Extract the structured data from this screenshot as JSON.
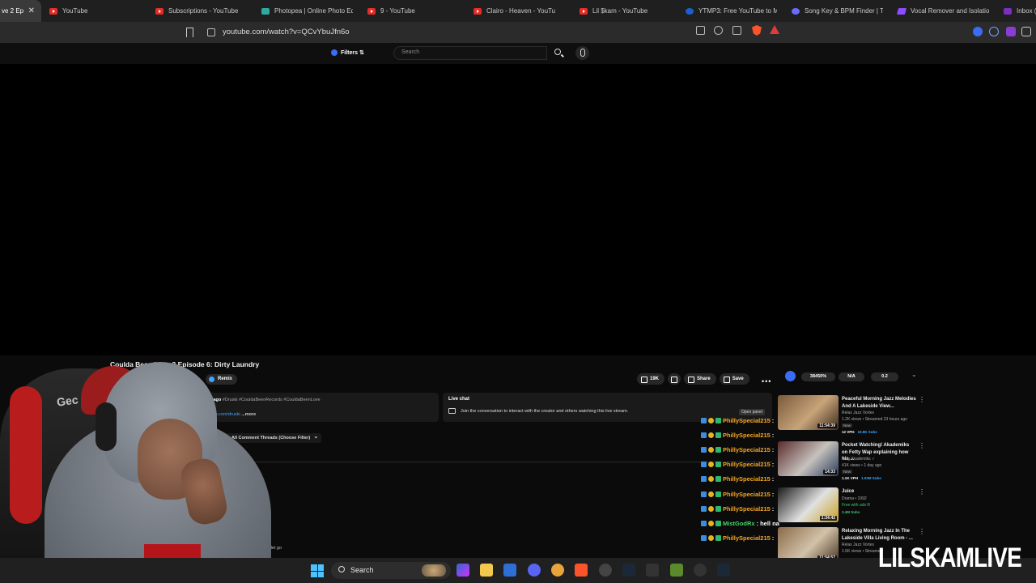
{
  "tabs": [
    {
      "label": "ve 2 Ep",
      "icon": "yt",
      "close": "✕",
      "active": true
    },
    {
      "label": "YouTube",
      "icon": "yt"
    },
    {
      "label": "Subscriptions - YouTube",
      "icon": "yt"
    },
    {
      "label": "Photopea | Online Photo Ed",
      "icon": "pp"
    },
    {
      "label": "9 - YouTube",
      "icon": "yt"
    },
    {
      "label": "Clairo - Heaven - YouTu",
      "icon": "yt"
    },
    {
      "label": "Lil $kam - YouTube",
      "icon": "yt"
    },
    {
      "label": "YTMP3: Free YouTube to M",
      "icon": "mp3"
    },
    {
      "label": "Song Key & BPM Finder | T",
      "icon": "song"
    },
    {
      "label": "Vocal Remover and Isolatio",
      "icon": "voc"
    },
    {
      "label": "Inbox (2",
      "icon": "mail"
    }
  ],
  "address": {
    "url": "youtube.com/watch?v=QCvYbuJfn6o"
  },
  "header": {
    "filters_label": "Filters ⇅",
    "search_placeholder": "Search"
  },
  "video": {
    "title": "Coulda Been Love 2 Episode 6: Dirty Laundry",
    "remix_label": "Remix",
    "like_count": "19K",
    "share_label": "Share",
    "save_label": "Save",
    "more_label": "•••"
  },
  "description": {
    "time_text": "tes ago",
    "hashtags": "#Druski #CouldaBeenRecords #CouldaBeenLove",
    "link_text": "gram.com/druski",
    "more_label": "...more"
  },
  "live_chat": {
    "title": "Live chat",
    "prompt": "Join the conversation to interact with the creator and others watching this live stream.",
    "open_panel_label": "Open panel"
  },
  "comments": {
    "sort_label": "All Comment Threads (Choose Filter)",
    "partial_text": "o let go"
  },
  "chat_messages": [
    {
      "name": "PhillySpecial215",
      "text": "",
      "color": "orange"
    },
    {
      "name": "PhillySpecial215",
      "text": "",
      "color": "orange"
    },
    {
      "name": "PhillySpecial215",
      "text": "",
      "color": "orange"
    },
    {
      "name": "PhillySpecial215",
      "text": "",
      "color": "orange"
    },
    {
      "name": "PhillySpecial215",
      "text": "",
      "color": "orange"
    },
    {
      "name": "PhillySpecial215",
      "text": "",
      "color": "orange"
    },
    {
      "name": "PhillySpecial215",
      "text": "",
      "color": "orange"
    },
    {
      "name": "MistGodRx",
      "text": "hell na",
      "color": "green"
    },
    {
      "name": "PhillySpecial215",
      "text": "",
      "color": "orange"
    }
  ],
  "extension_bar": {
    "stat1": "38450%",
    "stat2": "N/A",
    "stat3": "0.2"
  },
  "recommended": [
    {
      "title": "Peaceful Morning Jazz Melodies And A Lakeside View...",
      "channel": "Relax Jazz Vortex",
      "meta": "1.2K views • Streamed 23 hours ago",
      "badge": "New",
      "stat_a": "12 VPH",
      "stat_b": "19.8K Subs",
      "duration": "11:54:39",
      "thumb": [
        "#7a5a3c",
        "#c8a47a",
        "#3d2a1c"
      ]
    },
    {
      "title": "Pocket Watching! Akademiks on Fetty Wap explaining how his ...",
      "channel": "King Akademiks ✓",
      "meta": "41K views • 1 day ago",
      "badge": "New",
      "stat_a": "1.1K VPH",
      "stat_b": "1.03M Subs",
      "duration": "14:33",
      "thumb": [
        "#5b2b2b",
        "#c6c2bd",
        "#2a3a5a"
      ]
    },
    {
      "title": "Juice",
      "channel": "Drama • 1992",
      "meta": "Free with ads  R",
      "badge": "",
      "stat_a": "",
      "stat_b": "3.4M Subs",
      "duration": "1:34:42",
      "thumb": [
        "#1a1a1a",
        "#e1e1e1",
        "#c8a020"
      ]
    },
    {
      "title": "Relaxing Morning Jazz In The Lakeside Villa Living Room - ...",
      "channel": "Relax Jazz Vortex",
      "meta": "1.5K views • Streamed",
      "badge": "",
      "stat_a": "",
      "stat_b": "",
      "duration": "11:54:57",
      "thumb": [
        "#8a6a4a",
        "#d2c2a8",
        "#4a3524"
      ]
    }
  ],
  "webcam": {
    "logo_text": "Gec"
  },
  "taskbar": {
    "search_label": "Search"
  },
  "watermark": "LILSKAMLIVE"
}
